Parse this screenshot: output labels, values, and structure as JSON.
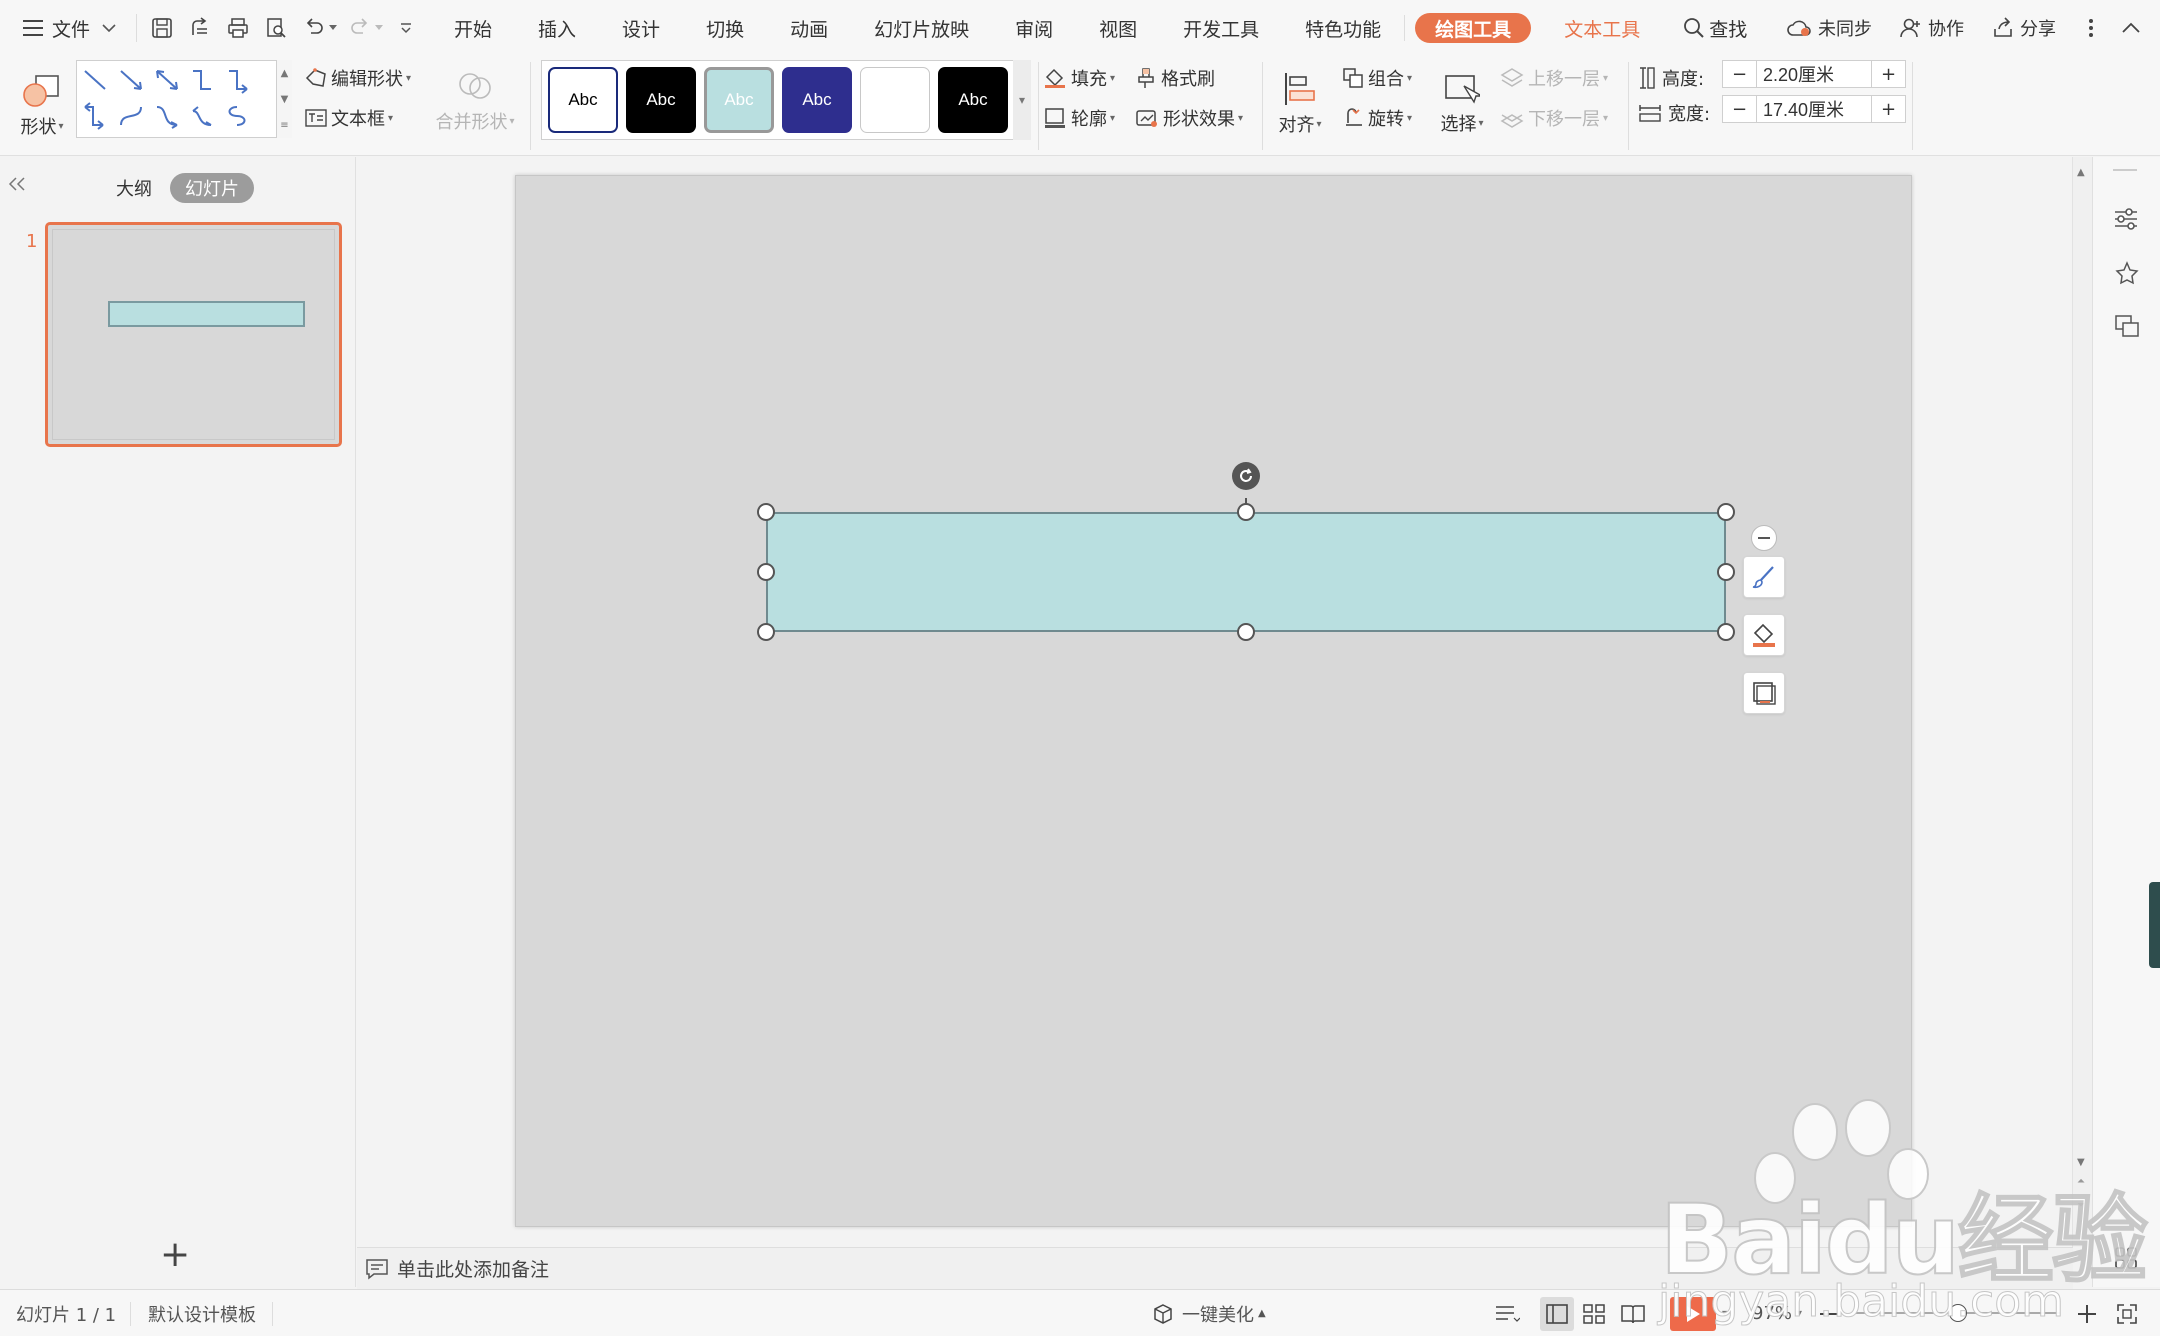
{
  "menubar": {
    "file_label": "文件",
    "tabs": [
      "开始",
      "插入",
      "设计",
      "切换",
      "动画",
      "幻灯片放映",
      "审阅",
      "视图",
      "开发工具",
      "特色功能"
    ],
    "active_tab": "绘图工具",
    "text_tool_tab": "文本工具",
    "find_label": "查找",
    "sync_label": "未同步",
    "collab_label": "协作",
    "share_label": "分享"
  },
  "ribbon": {
    "shape_label": "形状",
    "edit_shape_label": "编辑形状",
    "textbox_label": "文本框",
    "merge_shape_label": "合并形状",
    "style_swatches": [
      {
        "text": "Abc",
        "bg": "#ffffff",
        "fg": "#000000",
        "border": "#1a2a7a"
      },
      {
        "text": "Abc",
        "bg": "#000000",
        "fg": "#ffffff",
        "border": "#000000"
      },
      {
        "text": "Abc",
        "bg": "#b9dfe0",
        "fg": "#ffffff",
        "border": "#999999"
      },
      {
        "text": "Abc",
        "bg": "#2e2e8e",
        "fg": "#ffffff",
        "border": "#2e2e8e"
      },
      {
        "text": "",
        "bg": "#ffffff",
        "fg": "#000000",
        "border": "#c8c8c8"
      },
      {
        "text": "Abc",
        "bg": "#000000",
        "fg": "#ffffff",
        "border": "#000000"
      }
    ],
    "fill_label": "填充",
    "format_painter_label": "格式刷",
    "outline_label": "轮廓",
    "shape_effect_label": "形状效果",
    "align_label": "对齐",
    "group_label": "组合",
    "rotate_label": "旋转",
    "select_label": "选择",
    "bring_forward_label": "上移一层",
    "send_backward_label": "下移一层",
    "height_label": "高度:",
    "height_value": "2.20厘米",
    "width_label": "宽度:",
    "width_value": "17.40厘米",
    "minus": "−",
    "plus": "+"
  },
  "leftpanel": {
    "outline_tab": "大纲",
    "slides_tab": "幻灯片",
    "slide_number": "1",
    "add_slide": "+"
  },
  "notes": {
    "placeholder": "单击此处添加备注"
  },
  "statusbar": {
    "slide_info": "幻灯片 1 / 1",
    "template": "默认设计模板",
    "beautify": "一键美化",
    "zoom": "97%",
    "zoom_fraction": 0.5
  },
  "watermark": {
    "brand": "Baidu经验",
    "url": "jingyan.baidu.com"
  },
  "colors": {
    "accent": "#e8744b",
    "shape_fill": "#b9dfe0",
    "slide_bg": "#d8d8d8"
  }
}
